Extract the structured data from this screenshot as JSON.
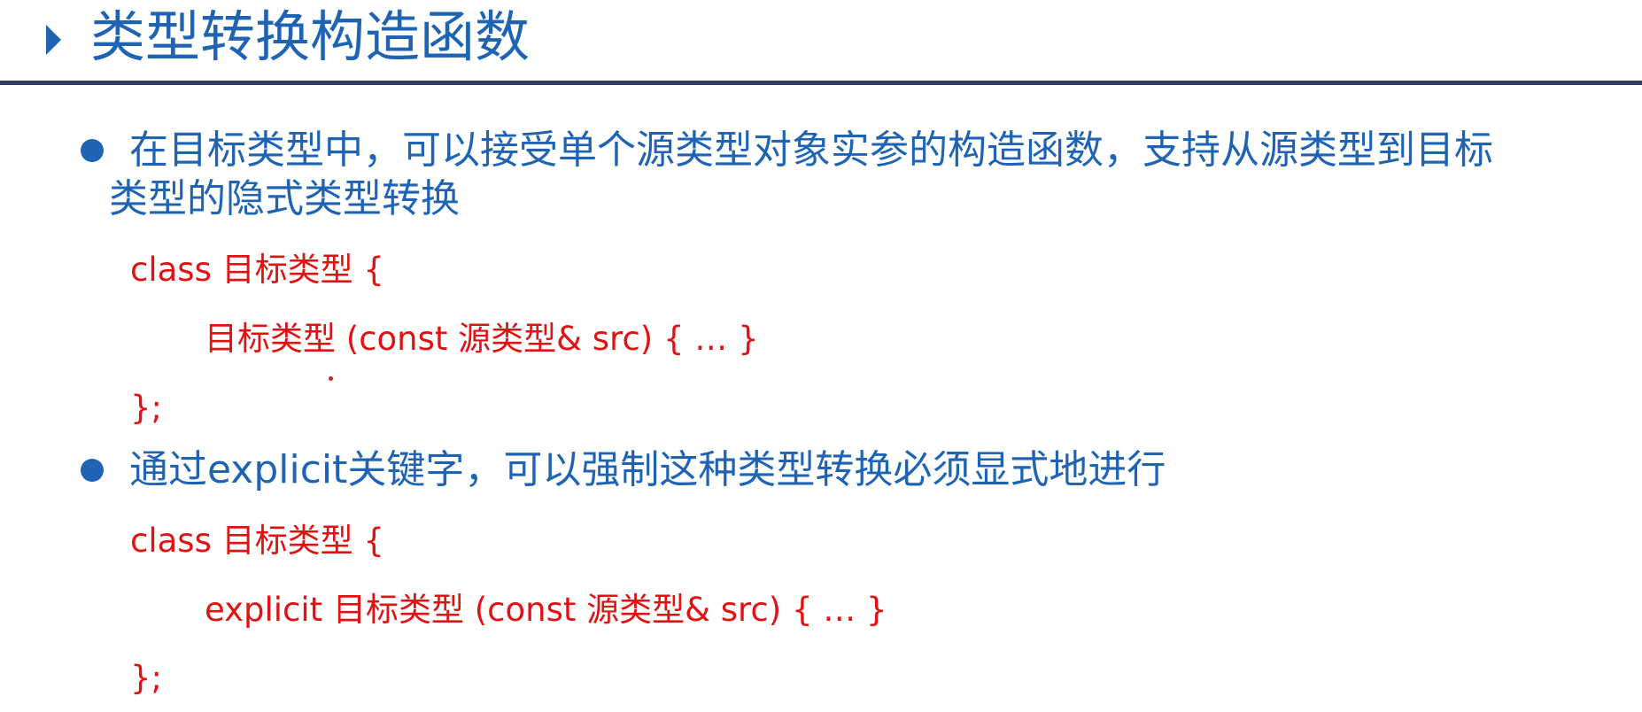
{
  "title": "类型转换构造函数",
  "colors": {
    "title": "#1f64b4",
    "rule": "#2f3a66",
    "bullet_text": "#1f64b4",
    "code": "#e21212"
  },
  "bullets": [
    {
      "line1": "在目标类型中，可以接受单个源类型对象实参的构造函数，支持从源类型到目标",
      "line2": "类型的隐式类型转换",
      "code": [
        "class 目标类型 {",
        "目标类型 (const 源类型& src) { … }",
        "};"
      ]
    },
    {
      "line1": "通过explicit关键字，可以强制这种类型转换必须显式地进行",
      "code": [
        "class 目标类型 {",
        "explicit 目标类型 (const 源类型& src) { … }",
        "};"
      ]
    }
  ]
}
